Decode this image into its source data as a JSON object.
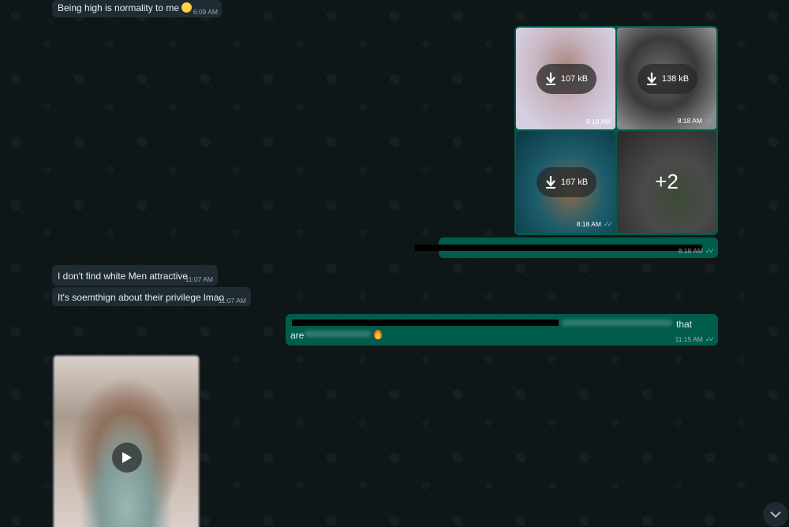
{
  "messages": {
    "high": {
      "text": "Being high is normality to me",
      "time": "6:09 AM"
    },
    "media": {
      "tiles": [
        {
          "size": "107 kB",
          "time": "8:18 AM"
        },
        {
          "size": "138 kB",
          "time": "8:18 AM"
        },
        {
          "size": "167 kB",
          "time": "8:18 AM"
        },
        {
          "more": "+2"
        }
      ],
      "caption_time": "8:18 AM"
    },
    "attractive": {
      "text": "I don't find white Men attractive",
      "time": "11:07 AM"
    },
    "privilege": {
      "text": "It's soemthign about their privilege lmao",
      "time": "11:07 AM"
    },
    "long_out": {
      "visible_end": "that",
      "visible_start": "are",
      "time": "11:15 AM"
    }
  },
  "colors": {
    "background": "#0f1618",
    "incoming": "#202c33",
    "outgoing": "#005c4b",
    "read_ticks": "#53bdeb"
  },
  "icons": [
    "download-icon",
    "play-icon",
    "chevron-down-icon",
    "double-check-icon",
    "fire-emoji",
    "grin-sweat-emoji"
  ]
}
